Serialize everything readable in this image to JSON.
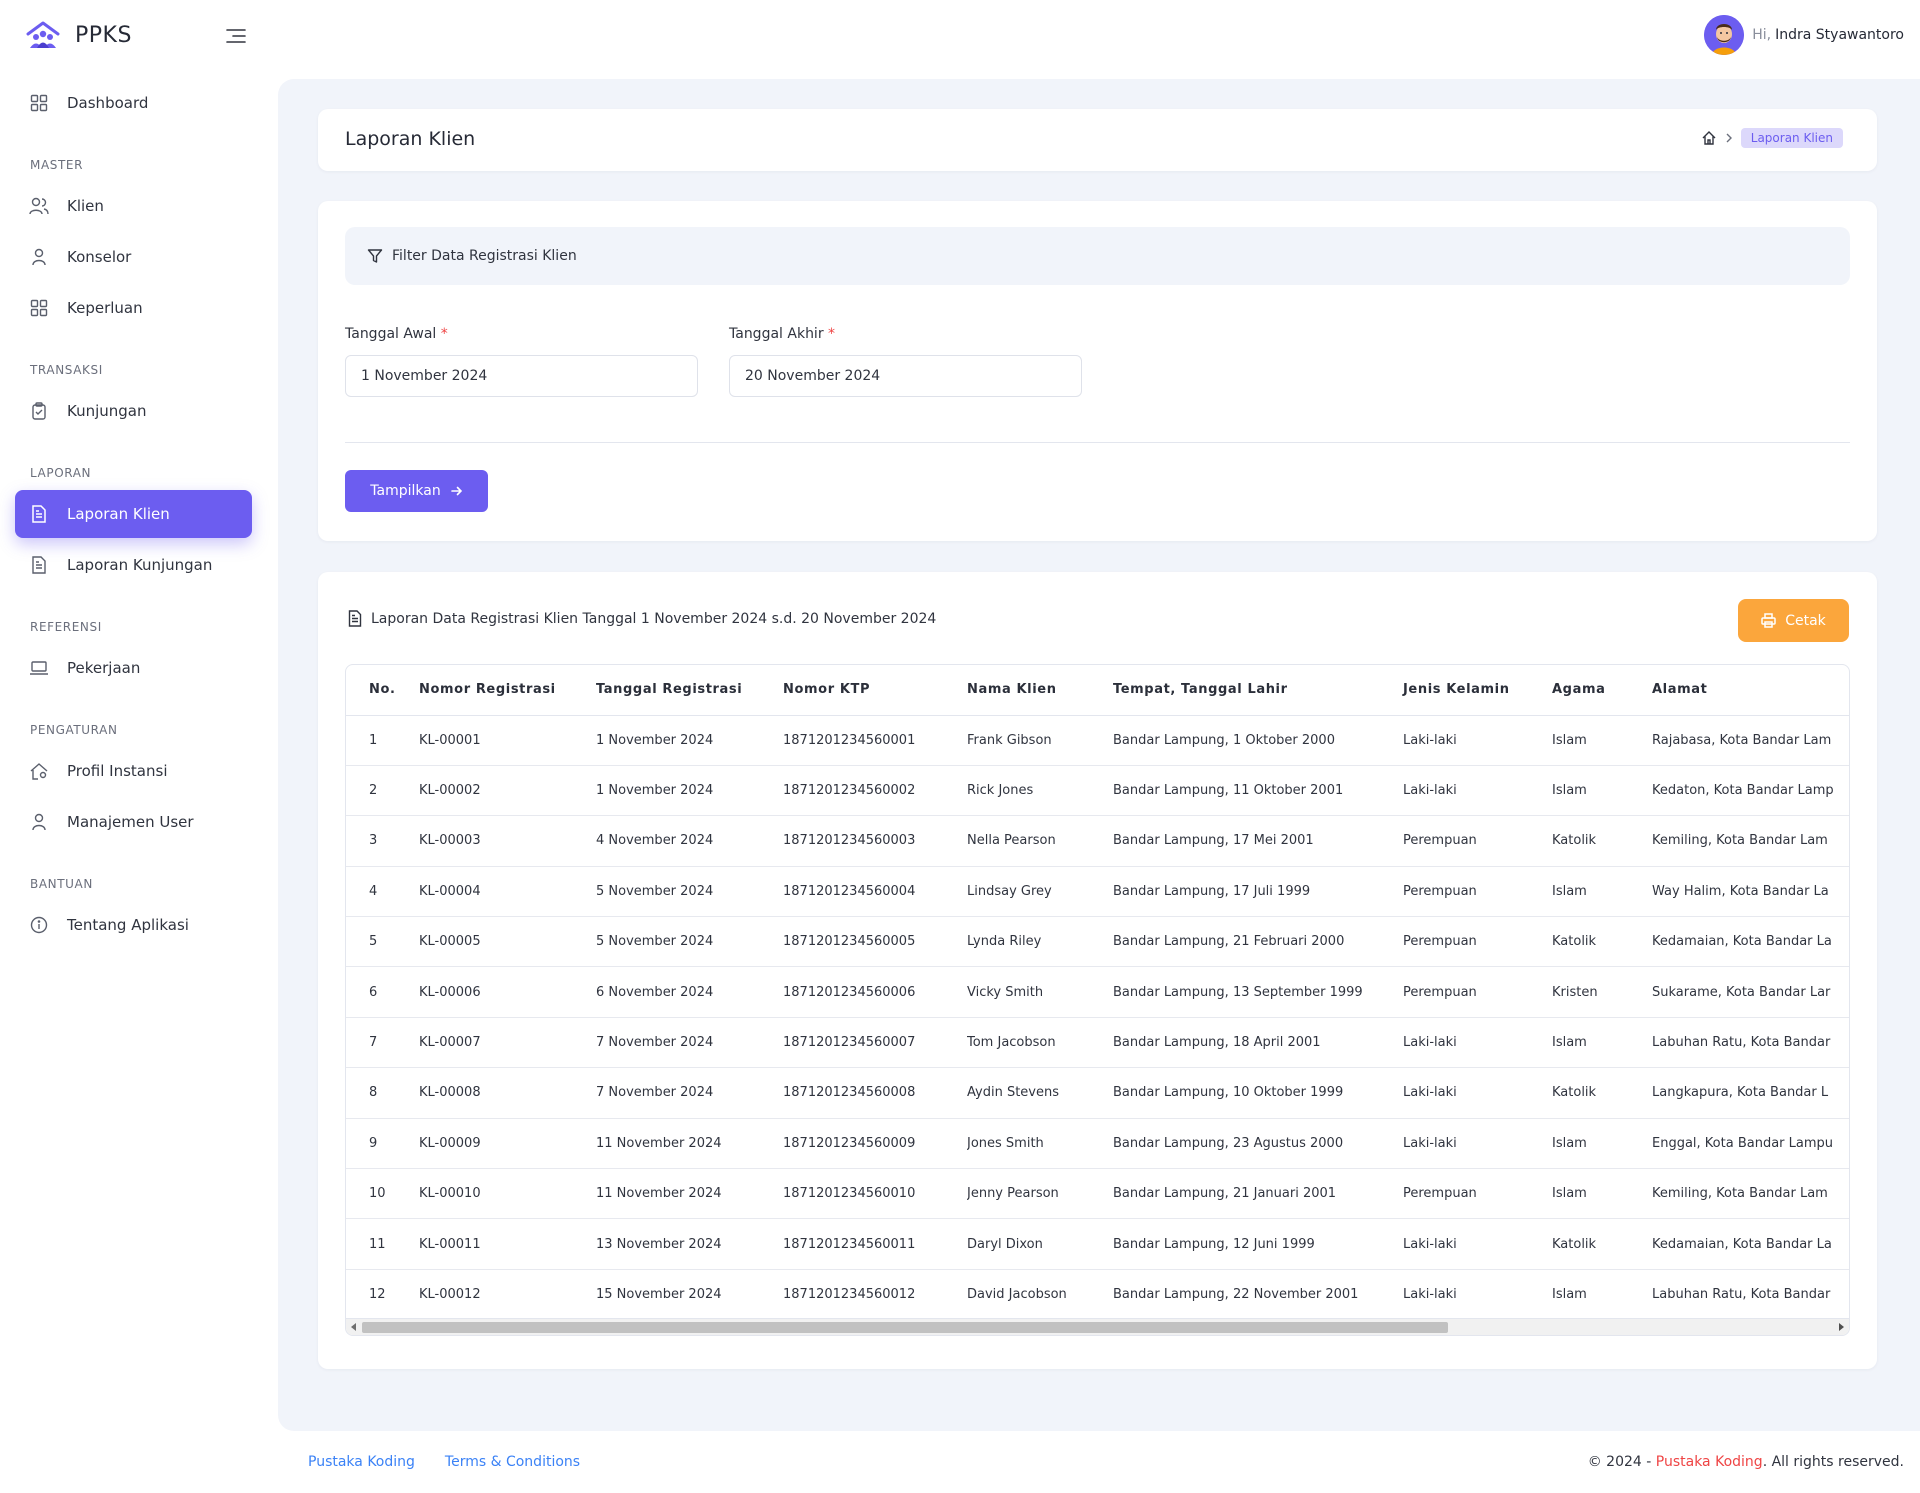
{
  "app": {
    "name": "PPKS",
    "brand_color": "#6c5df0"
  },
  "user": {
    "greeting": "Hi,",
    "name": "Indra Styawantoro"
  },
  "sidebar": {
    "dashboard": "Dashboard",
    "sections": {
      "master": "MASTER",
      "transaksi": "TRANSAKSI",
      "laporan": "LAPORAN",
      "referensi": "REFERENSI",
      "pengaturan": "PENGATURAN",
      "bantuan": "BANTUAN"
    },
    "items": {
      "klien": "Klien",
      "konselor": "Konselor",
      "keperluan": "Keperluan",
      "kunjungan": "Kunjungan",
      "laporan_klien": "Laporan Klien",
      "laporan_kunjungan": "Laporan Kunjungan",
      "pekerjaan": "Pekerjaan",
      "profil_instansi": "Profil Instansi",
      "manajemen_user": "Manajemen User",
      "tentang_aplikasi": "Tentang Aplikasi"
    },
    "active": "laporan_klien"
  },
  "page": {
    "title": "Laporan Klien",
    "breadcrumb_current": "Laporan Klien"
  },
  "filter": {
    "heading": "Filter Data Registrasi Klien",
    "start_label": "Tanggal Awal",
    "end_label": "Tanggal Akhir",
    "required_mark": "*",
    "start_value": "1 November 2024",
    "end_value": "20 November 2024",
    "submit_label": "Tampilkan"
  },
  "report": {
    "title": "Laporan Data Registrasi Klien Tanggal 1 November 2024 s.d. 20 November 2024",
    "print_label": "Cetak",
    "columns": [
      "No.",
      "Nomor Registrasi",
      "Tanggal Registrasi",
      "Nomor KTP",
      "Nama Klien",
      "Tempat, Tanggal Lahir",
      "Jenis Kelamin",
      "Agama",
      "Alamat"
    ],
    "rows": [
      [
        "1",
        "KL-00001",
        "1 November 2024",
        "1871201234560001",
        "Frank Gibson",
        "Bandar Lampung, 1 Oktober 2000",
        "Laki-laki",
        "Islam",
        "Rajabasa, Kota Bandar Lam"
      ],
      [
        "2",
        "KL-00002",
        "1 November 2024",
        "1871201234560002",
        "Rick Jones",
        "Bandar Lampung, 11 Oktober 2001",
        "Laki-laki",
        "Islam",
        "Kedaton, Kota Bandar Lamp"
      ],
      [
        "3",
        "KL-00003",
        "4 November 2024",
        "1871201234560003",
        "Nella Pearson",
        "Bandar Lampung, 17 Mei 2001",
        "Perempuan",
        "Katolik",
        "Kemiling, Kota Bandar Lam"
      ],
      [
        "4",
        "KL-00004",
        "5 November 2024",
        "1871201234560004",
        "Lindsay Grey",
        "Bandar Lampung, 17 Juli 1999",
        "Perempuan",
        "Islam",
        "Way Halim, Kota Bandar La"
      ],
      [
        "5",
        "KL-00005",
        "5 November 2024",
        "1871201234560005",
        "Lynda Riley",
        "Bandar Lampung, 21 Februari 2000",
        "Perempuan",
        "Katolik",
        "Kedamaian, Kota Bandar La"
      ],
      [
        "6",
        "KL-00006",
        "6 November 2024",
        "1871201234560006",
        "Vicky Smith",
        "Bandar Lampung, 13 September 1999",
        "Perempuan",
        "Kristen",
        "Sukarame, Kota Bandar Lar"
      ],
      [
        "7",
        "KL-00007",
        "7 November 2024",
        "1871201234560007",
        "Tom Jacobson",
        "Bandar Lampung, 18 April 2001",
        "Laki-laki",
        "Islam",
        "Labuhan Ratu, Kota Bandar"
      ],
      [
        "8",
        "KL-00008",
        "7 November 2024",
        "1871201234560008",
        "Aydin Stevens",
        "Bandar Lampung, 10 Oktober 1999",
        "Laki-laki",
        "Katolik",
        "Langkapura, Kota Bandar L"
      ],
      [
        "9",
        "KL-00009",
        "11 November 2024",
        "1871201234560009",
        "Jones Smith",
        "Bandar Lampung, 23 Agustus 2000",
        "Laki-laki",
        "Islam",
        "Enggal, Kota Bandar Lampu"
      ],
      [
        "10",
        "KL-00010",
        "11 November 2024",
        "1871201234560010",
        "Jenny Pearson",
        "Bandar Lampung, 21 Januari 2001",
        "Perempuan",
        "Islam",
        "Kemiling, Kota Bandar Lam"
      ],
      [
        "11",
        "KL-00011",
        "13 November 2024",
        "1871201234560011",
        "Daryl Dixon",
        "Bandar Lampung, 12 Juni 1999",
        "Laki-laki",
        "Katolik",
        "Kedamaian, Kota Bandar La"
      ],
      [
        "12",
        "KL-00012",
        "15 November 2024",
        "1871201234560012",
        "David Jacobson",
        "Bandar Lampung, 22 November 2001",
        "Laki-laki",
        "Islam",
        "Labuhan Ratu, Kota Bandar"
      ]
    ]
  },
  "footer": {
    "link1": "Pustaka Koding",
    "link2": "Terms & Conditions",
    "copyright_prefix": "© 2024 - ",
    "copyright_brand": "Pustaka Koding",
    "copyright_suffix": ". All rights reserved."
  },
  "colors": {
    "primary": "#6c5df0",
    "print_button": "#fba63c",
    "link": "#3b82f6",
    "required": "#ef4444"
  }
}
